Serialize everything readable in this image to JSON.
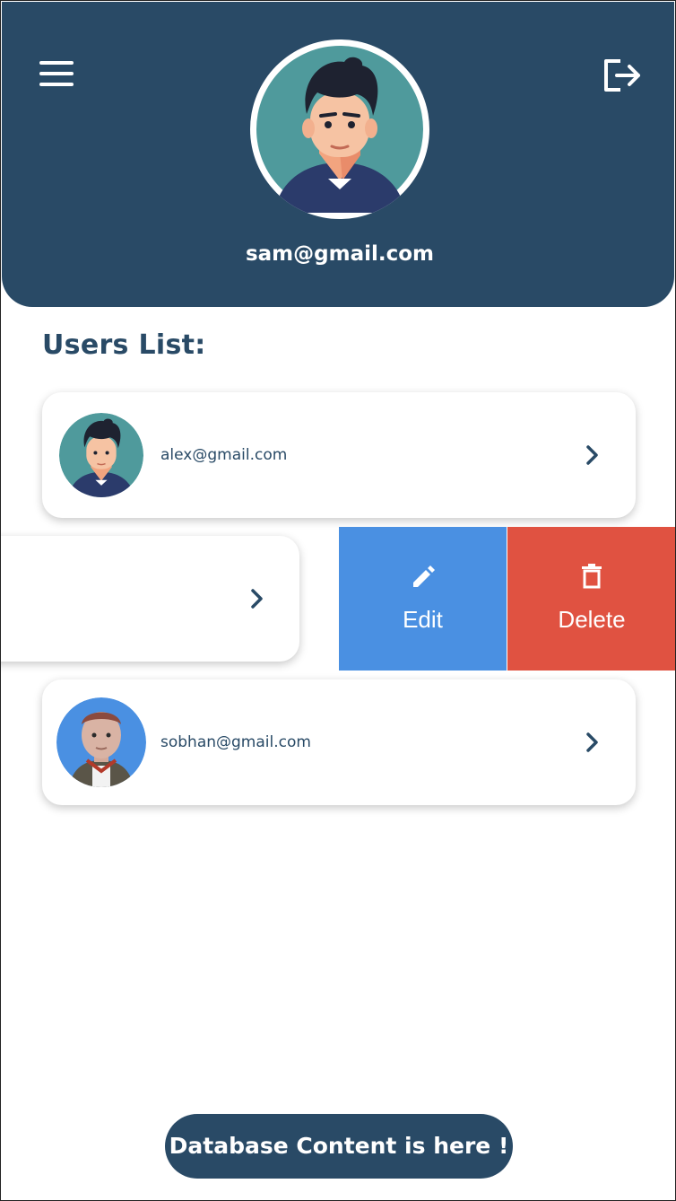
{
  "header": {
    "email": "sam@gmail.com",
    "menu_icon": "hamburger-menu-icon",
    "logout_icon": "logout-icon",
    "color": "#294a66"
  },
  "users_list": {
    "title": "Users List:",
    "items": [
      {
        "email": "alex@gmail.com",
        "avatar": "male-avatar-teal"
      },
      {
        "email": "",
        "avatar": "",
        "swiped_open": true
      },
      {
        "email": "sobhan@gmail.com",
        "avatar": "3d-avatar-blue"
      }
    ]
  },
  "swipe_actions": {
    "edit": {
      "label": "Edit",
      "icon": "pencil-icon",
      "color": "#4a90e2"
    },
    "delete": {
      "label": "Delete",
      "icon": "trash-icon",
      "color": "#e05241"
    }
  },
  "footer": {
    "button_label": "Database Content is here !"
  }
}
